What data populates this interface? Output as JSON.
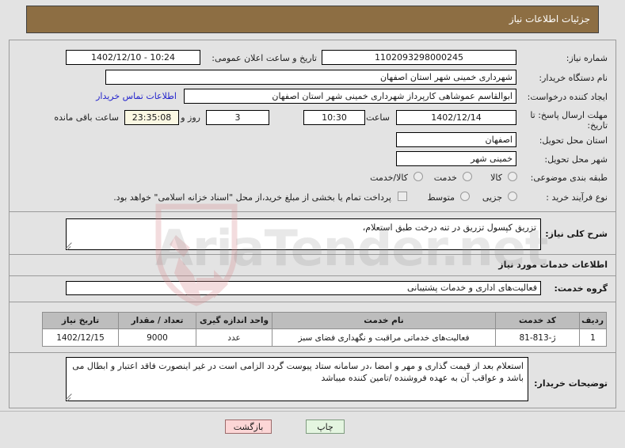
{
  "header": {
    "title": "جزئیات اطلاعات نیاز"
  },
  "form": {
    "need_number_label": "شماره نیاز:",
    "need_number_value": "1102093298000245",
    "announce_label": "تاریخ و ساعت اعلان عمومی:",
    "announce_value": "10:24 - 1402/12/10",
    "buyer_org_label": "نام دستگاه خریدار:",
    "buyer_org_value": "شهرداری خمینی شهر استان اصفهان",
    "requester_label": "ایجاد کننده درخواست:",
    "requester_value": "ابوالقاسم عموشاهی کارپرداز شهرداری خمینی شهر استان اصفهان",
    "contact_link": "اطلاعات تماس خریدار",
    "deadline_label": "مهلت ارسال پاسخ: تا تاریخ:",
    "deadline_date": "1402/12/14",
    "time_label": "ساعت",
    "deadline_time": "10:30",
    "days_value": "3",
    "days_label": "روز و",
    "countdown_value": "23:35:08",
    "countdown_label": "ساعت باقی مانده",
    "province_label": "استان محل تحویل:",
    "province_value": "اصفهان",
    "city_label": "شهر محل تحویل:",
    "city_value": "خمینی شهر",
    "category_label": "طبقه بندی موضوعی:",
    "category_options": [
      "کالا",
      "خدمت",
      "کالا/خدمت"
    ],
    "purchase_type_label": "نوع فرآیند خرید :",
    "purchase_type_options": [
      "جزیی",
      "متوسط"
    ],
    "treasury_checkbox_text": "پرداخت تمام یا بخشی از مبلغ خرید،از محل \"اسناد خزانه اسلامی\" خواهد بود."
  },
  "description": {
    "label": "شرح کلی نیاز:",
    "value": "تزریق کپسول تزریق در تنه درخت طبق استعلام،"
  },
  "services": {
    "heading": "اطلاعات خدمات مورد نیاز",
    "group_label": "گروه خدمت:",
    "group_value": "فعالیت‌های اداری و خدمات پشتیبانی"
  },
  "table": {
    "columns": [
      "ردیف",
      "کد خدمت",
      "نام خدمت",
      "واحد اندازه گیری",
      "تعداد / مقدار",
      "تاریخ نیاز"
    ],
    "rows": [
      {
        "row": "1",
        "code": "ژ-813-81",
        "name": "فعالیت‌های خدماتی مراقبت و نگهداری فضای سبز",
        "unit": "عدد",
        "quantity": "9000",
        "date": "1402/12/15"
      }
    ]
  },
  "buyer_notes": {
    "label": "توضیحات خریدار:",
    "value": "استعلام بعد از قیمت گذاری و مهر و امضا ،در سامانه ستاد پیوست گردد الزامی است در غیر اینصورت فاقد اعتبار و ابطال می باشد و عواقب آن به عهده فروشنده /تامین کننده میباشد"
  },
  "footer": {
    "back_label": "بازگشت",
    "print_label": "چاپ"
  },
  "watermark": {
    "text": "AriaTender.net"
  },
  "colors": {
    "header_bg": "#8d6e43",
    "page_bg": "#e3e3e3",
    "link": "#2222cc",
    "table_header_bg": "#bdbdbd",
    "back_btn_bg": "#fcd6d6",
    "print_btn_bg": "#e4f5e0",
    "countdown_bg": "#fbf8e3"
  }
}
